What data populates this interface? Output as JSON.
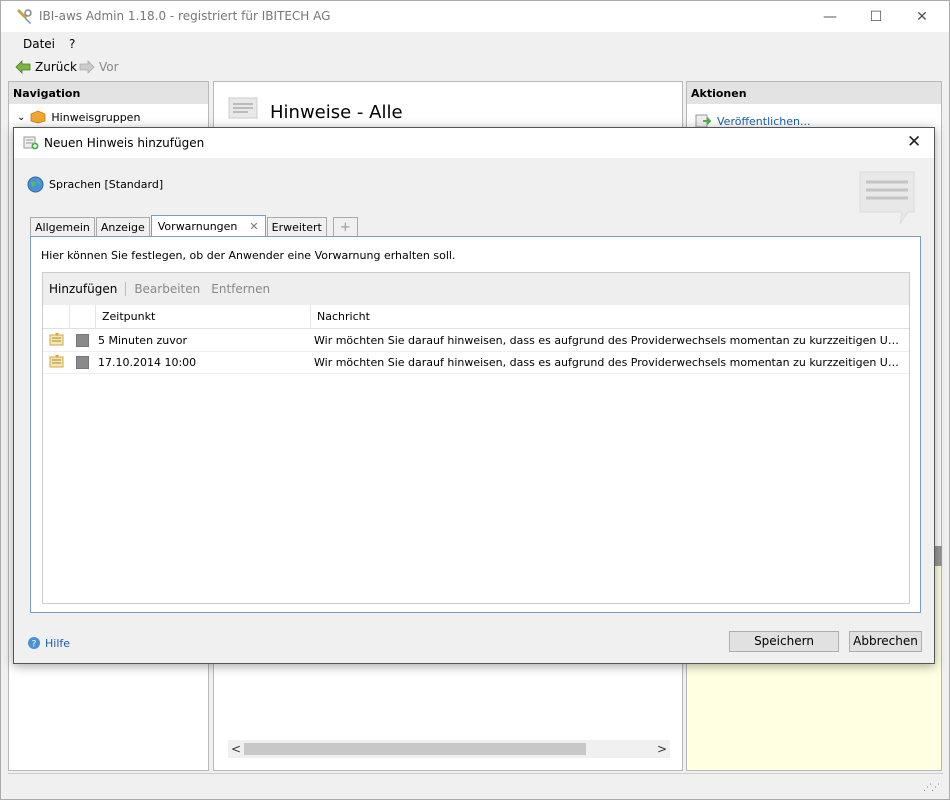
{
  "window": {
    "title": "IBI-aws Admin 1.18.0 - registriert für IBITECH AG",
    "minimize": "—",
    "maximize": "☐",
    "close": "✕"
  },
  "menu": {
    "file": "Datei",
    "help": "?"
  },
  "toolbar": {
    "back": "Zurück",
    "forward": "Vor"
  },
  "navigation": {
    "header": "Navigation",
    "items": [
      {
        "label": "Hinweisgruppen",
        "icon": "folder-box-icon"
      }
    ]
  },
  "content": {
    "title": "Hinweise - Alle",
    "scroll_left": "<",
    "scroll_right": ">"
  },
  "actions": {
    "header": "Aktionen",
    "items": [
      {
        "label": "Veröffentlichen...",
        "icon": "publish-icon"
      }
    ]
  },
  "dialog": {
    "title": "Neuen Hinweis hinzufügen",
    "close": "✕",
    "language": "Sprachen [Standard]",
    "tabs": [
      "Allgemein",
      "Anzeige",
      "Vorwarnungen",
      "Erweitert"
    ],
    "active_tab": "Vorwarnungen",
    "tab_close": "✕",
    "tab_add": "+",
    "hint": "Hier können Sie festlegen, ob der Anwender eine Vorwarnung erhalten soll.",
    "list_toolbar": {
      "add": "Hinzufügen",
      "edit": "Bearbeiten",
      "remove": "Entfernen"
    },
    "columns": {
      "time": "Zeitpunkt",
      "message": "Nachricht"
    },
    "rows": [
      {
        "time": "5 Minuten zuvor",
        "message": "Wir möchten Sie darauf hinweisen, dass es aufgrund des Providerwechsels momentan zu kurzzeitigen Unterbrec..."
      },
      {
        "time": "17.10.2014 10:00",
        "message": "Wir möchten Sie darauf hinweisen, dass es aufgrund des Providerwechsels momentan zu kurzzeitigen Unterbrec..."
      }
    ],
    "help": "Hilfe",
    "save": "Speichern",
    "cancel": "Abbrechen"
  },
  "colors": {
    "link": "#1a5fb4",
    "tab_border": "#7a9cc6",
    "info_panel": "#ffffe1",
    "pane_header": "#e3e3e3"
  }
}
